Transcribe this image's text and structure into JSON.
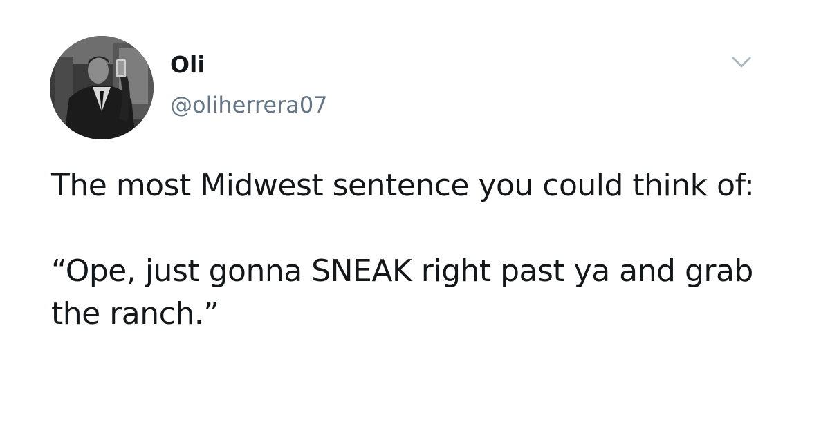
{
  "tweet": {
    "author": {
      "display_name": "Oli",
      "handle": "@oliherrera07"
    },
    "paragraphs": [
      "The most Midwest sentence you could think of:",
      "“Ope, just gonna SNEAK right past ya and grab the ranch.”"
    ],
    "menu_icon": "chevron-down-icon",
    "colors": {
      "text": "#14171a",
      "secondary_text": "#657786",
      "background": "#ffffff"
    }
  }
}
